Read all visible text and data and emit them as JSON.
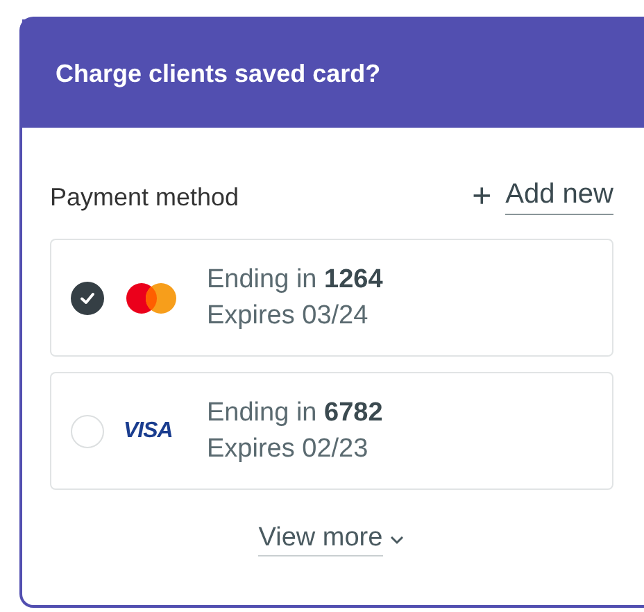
{
  "dialog": {
    "title": "Charge clients saved card?"
  },
  "payment": {
    "label": "Payment method",
    "add_icon": "+",
    "add_link": "Add new"
  },
  "cards": [
    {
      "kind": "mastercard",
      "selected": true,
      "line1": "Ending in **1264**",
      "line2": "Expires 03/24"
    },
    {
      "kind": "visa",
      "logo": "VISA",
      "selected": false,
      "line1": "Ending in **6782**",
      "line2": "Expires 02/23"
    }
  ],
  "view_more": "View more"
}
